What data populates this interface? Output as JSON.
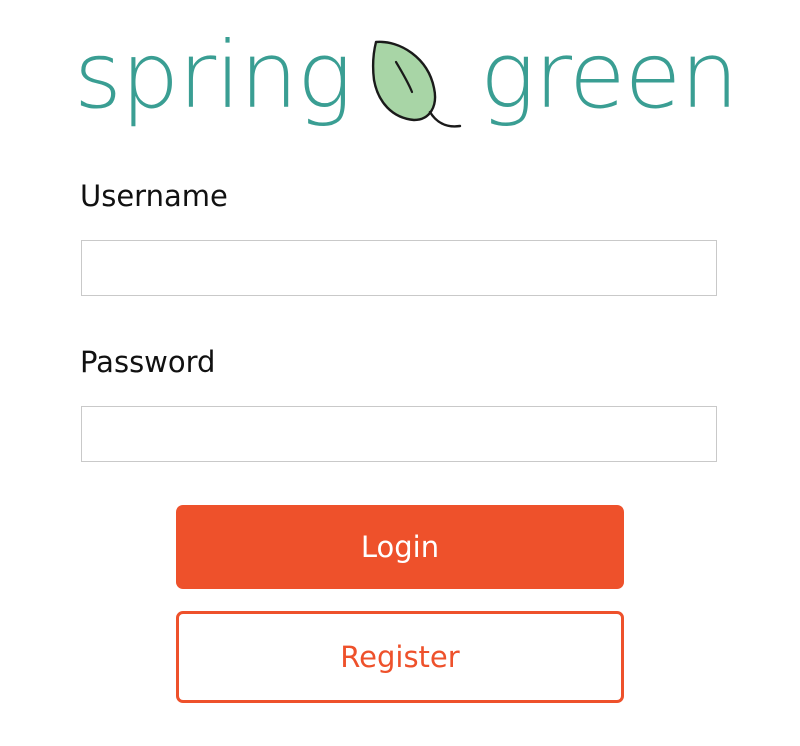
{
  "brand": {
    "word_left": "spring",
    "word_right": "green",
    "logo_icon": "leaf-icon",
    "text_color": "#3a9e93",
    "leaf_fill": "#a8d5a6",
    "leaf_stroke": "#1a1a1a"
  },
  "form": {
    "username": {
      "label": "Username",
      "value": "",
      "placeholder": ""
    },
    "password": {
      "label": "Password",
      "value": "",
      "placeholder": ""
    }
  },
  "actions": {
    "login_label": "Login",
    "register_label": "Register",
    "accent_color": "#ee512b",
    "login_text_color": "#ffffff"
  }
}
